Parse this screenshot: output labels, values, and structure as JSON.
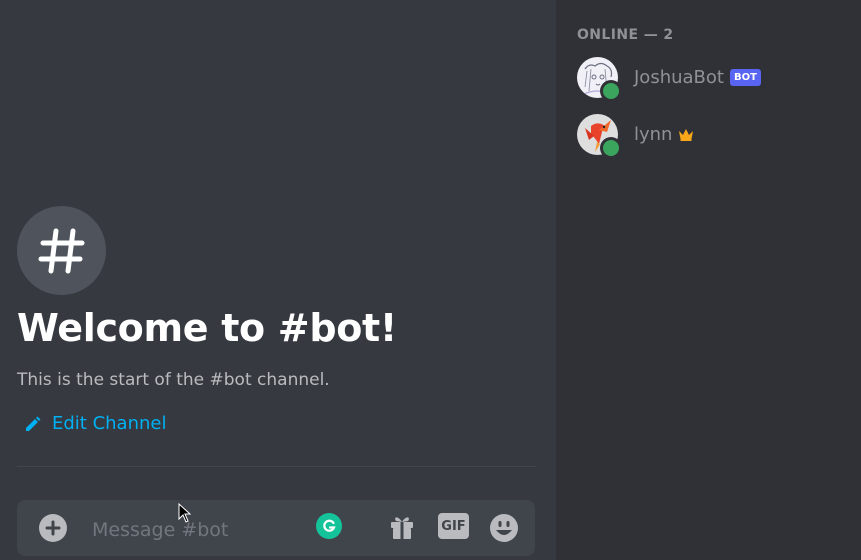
{
  "welcome": {
    "title": "Welcome to #bot!",
    "subtitle": "This is the start of the #bot channel.",
    "edit_label": "Edit Channel"
  },
  "composer": {
    "placeholder": "Message #bot",
    "gif_label": "GIF"
  },
  "members": {
    "header": "ONLINE — 2",
    "items": [
      {
        "name": "JoshuaBot",
        "tag": "BOT",
        "status": "online"
      },
      {
        "name": "lynn",
        "badge": "crown-icon",
        "status": "online"
      }
    ]
  },
  "colors": {
    "background": "#36393f",
    "sidebar": "#2f3136",
    "link": "#00b0f4",
    "online": "#3ba55d",
    "bot_tag": "#5865f2",
    "crown": "#faa61a",
    "grammarly": "#15c39a"
  }
}
